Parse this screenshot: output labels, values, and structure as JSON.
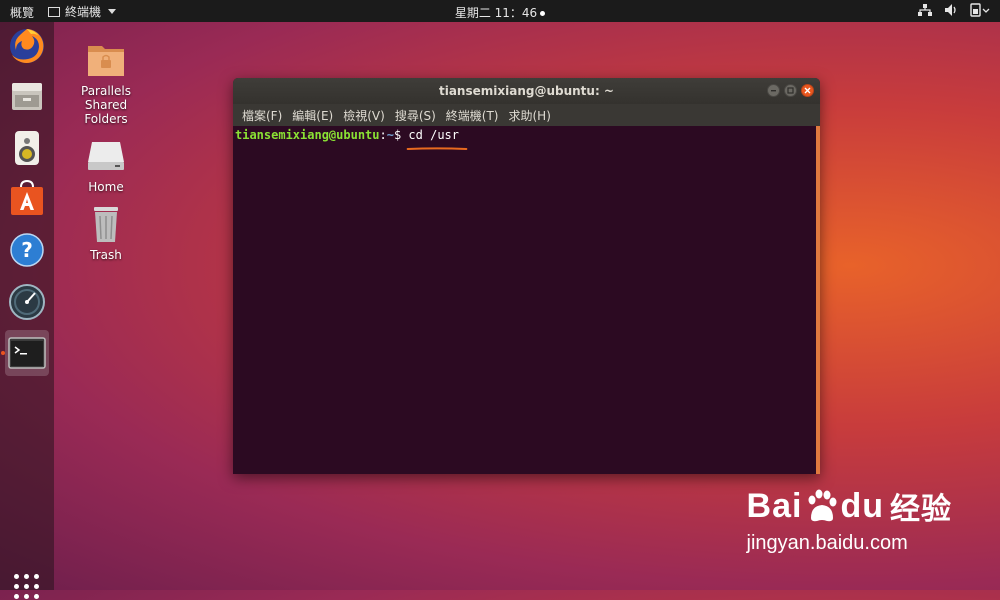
{
  "topbar": {
    "activities": "概覽",
    "app_menu": "終端機",
    "clock": "星期二 11：46"
  },
  "dock": {
    "items": [
      {
        "name": "firefox"
      },
      {
        "name": "files"
      },
      {
        "name": "rhythmbox"
      },
      {
        "name": "ubuntu-software"
      },
      {
        "name": "help"
      },
      {
        "name": "disk-usage"
      },
      {
        "name": "terminal",
        "active": true
      }
    ]
  },
  "desktop": {
    "icons": [
      {
        "label": "Parallels\nShared\nFolders"
      },
      {
        "label": "Home"
      },
      {
        "label": "Trash"
      }
    ]
  },
  "terminal": {
    "title": "tiansemixiang@ubuntu: ~",
    "menu": [
      "檔案(F)",
      "編輯(E)",
      "檢視(V)",
      "搜尋(S)",
      "終端機(T)",
      "求助(H)"
    ],
    "prompt_user": "tiansemixiang@ubuntu",
    "prompt_sep": ":",
    "prompt_path": "~",
    "prompt_symbol": "$ ",
    "command": "cd /usr"
  },
  "watermark": {
    "logo_text": "Bai",
    "logo_text2": "du",
    "logo_cn": "经验",
    "url": "jingyan.baidu.com"
  },
  "colors": {
    "accent": "#e95420",
    "terminal_bg": "#2c0a22",
    "prompt_user": "#8ae234",
    "prompt_path": "#729fcf"
  }
}
